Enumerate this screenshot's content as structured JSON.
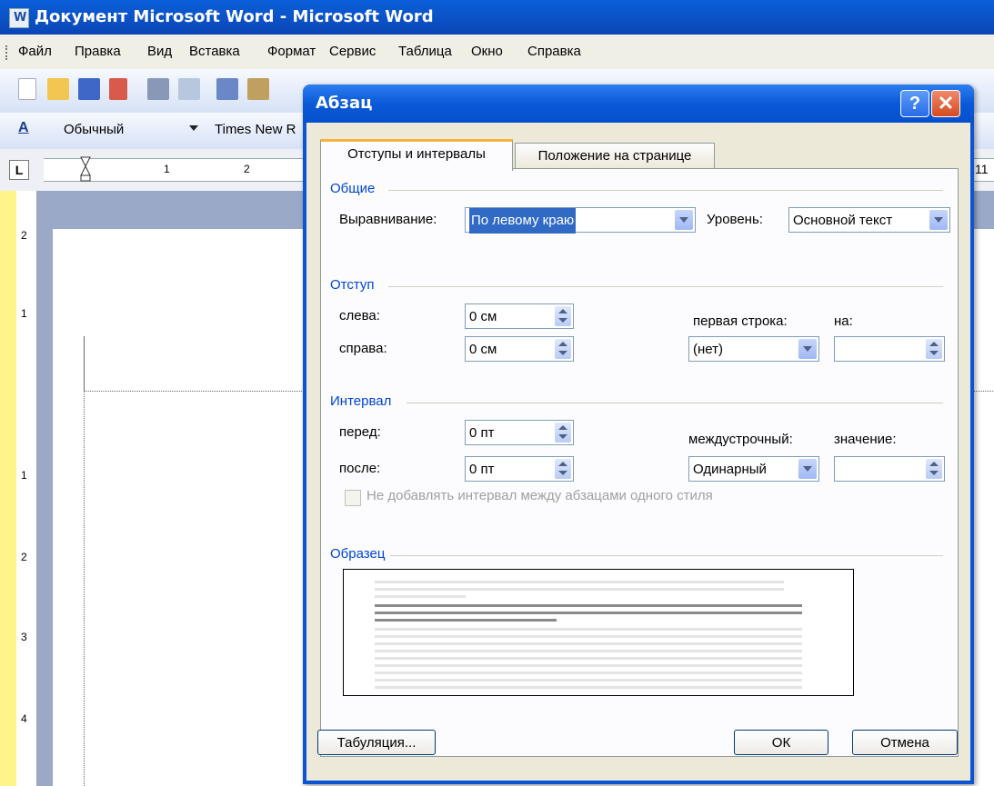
{
  "word": {
    "title": "Документ Microsoft Word - Microsoft Word",
    "menu": [
      "Файл",
      "Правка",
      "Вид",
      "Вставка",
      "Формат",
      "Сервис",
      "Таблица",
      "Окно",
      "Справка"
    ],
    "style_box": "Обычный",
    "font_box": "Times New R",
    "ruler_numbers": [
      "1",
      "2"
    ],
    "ruler_right_number": "11",
    "vruler_numbers": [
      "2",
      "1",
      "1",
      "2",
      "3",
      "4"
    ]
  },
  "dialog": {
    "title": "Абзац",
    "help_label": "?",
    "close_label": "✕",
    "tabs": [
      "Отступы и интервалы",
      "Положение на странице"
    ],
    "general": {
      "heading": "Общие",
      "alignment_label": "Выравнивание:",
      "alignment_value": "По левому краю",
      "level_label": "Уровень:",
      "level_value": "Основной текст"
    },
    "indent": {
      "heading": "Отступ",
      "left_label": "слева:",
      "left_value": "0 см",
      "right_label": "справа:",
      "right_value": "0 см",
      "first_line_label": "первая строка:",
      "first_line_value": "(нет)",
      "by_label": "на:",
      "by_value": ""
    },
    "spacing": {
      "heading": "Интервал",
      "before_label": "перед:",
      "before_value": "0 пт",
      "after_label": "после:",
      "after_value": "0 пт",
      "line_spacing_label": "междустрочный:",
      "line_spacing_value": "Одинарный",
      "at_label": "значение:",
      "at_value": "",
      "no_space_label": "Не добавлять интервал между абзацами одного стиля",
      "no_space_checked": false
    },
    "preview": {
      "heading": "Образец"
    },
    "buttons": {
      "tabs": "Табуляция...",
      "ok": "ОК",
      "cancel": "Отмена"
    }
  }
}
